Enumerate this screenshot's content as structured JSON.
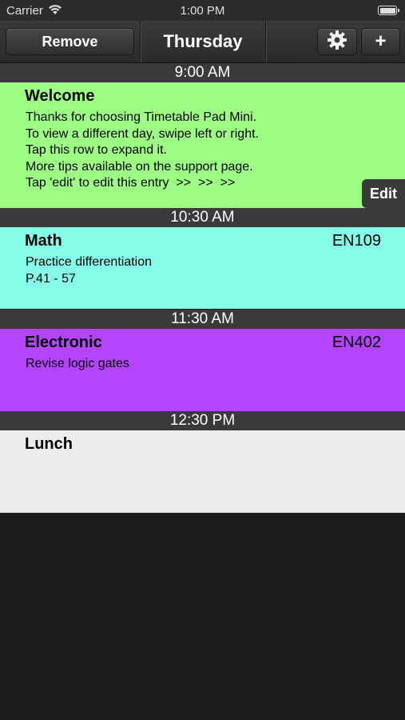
{
  "status": {
    "carrier": "Carrier",
    "time": "1:00 PM"
  },
  "toolbar": {
    "remove_label": "Remove",
    "day": "Thursday",
    "add_label": "+",
    "settings_icon": "gear-icon"
  },
  "entries": [
    {
      "time": "9:00 AM",
      "title": "Welcome",
      "room": "",
      "color": "#9cfc83",
      "lines": [
        "Thanks for choosing Timetable Pad Mini.",
        "To view a different day, swipe left or right.",
        "Tap this row to expand it.",
        "More tips available on the support page.",
        "Tap 'edit' to edit this entry  >>  >>  >>"
      ],
      "edit_label": "Edit"
    },
    {
      "time": "10:30 AM",
      "title": "Math",
      "room": "EN109",
      "color": "#85fde8",
      "lines": [
        "Practice differentiation",
        "P.41 - 57"
      ]
    },
    {
      "time": "11:30 AM",
      "title": "Electronic",
      "room": "EN402",
      "color": "#b545fd",
      "lines": [
        "Revise logic gates"
      ]
    },
    {
      "time": "12:30 PM",
      "title": "Lunch",
      "room": "",
      "color": "#ededed",
      "lines": []
    }
  ]
}
